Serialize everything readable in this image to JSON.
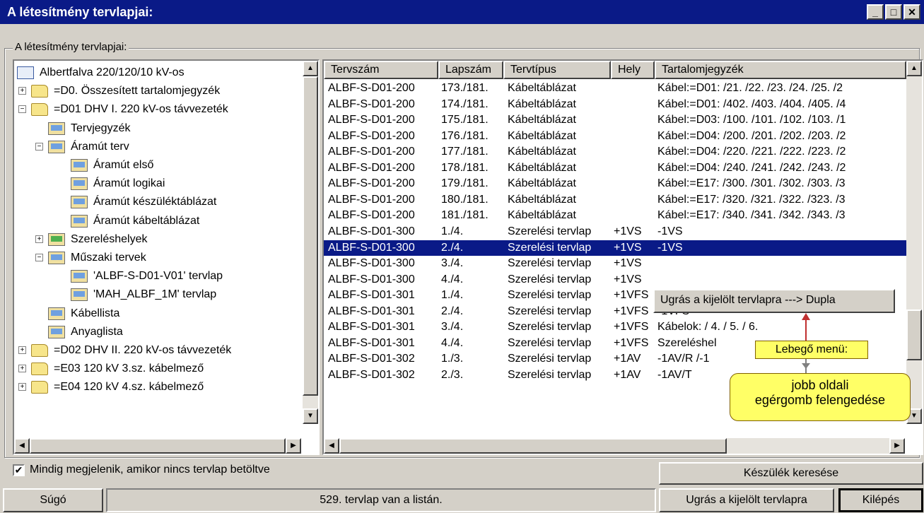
{
  "window": {
    "title": "A létesítmény tervlapjai:"
  },
  "group_label": "A létesítmény tervlapjai:",
  "tree": [
    {
      "label": "Albertfalva 220/120/10 kV-os",
      "icon": "document-icon",
      "level": 0,
      "expander": ""
    },
    {
      "label": "=D0. Összesített tartalomjegyzék",
      "icon": "folder-icon",
      "level": 1,
      "expander": "+"
    },
    {
      "label": "=D01 DHV I. 220 kV-os távvezeték",
      "icon": "folder-open-icon",
      "level": 1,
      "expander": "-"
    },
    {
      "label": "Tervjegyzék",
      "icon": "sheet-icon",
      "level": 2,
      "expander": ""
    },
    {
      "label": "Áramút terv",
      "icon": "sheet-icon",
      "level": 2,
      "expander": "-"
    },
    {
      "label": "Áramút első",
      "icon": "sheet-icon",
      "level": 3,
      "expander": ""
    },
    {
      "label": "Áramút logikai",
      "icon": "sheet-icon",
      "level": 3,
      "expander": ""
    },
    {
      "label": "Áramút készüléktáblázat",
      "icon": "sheet-icon",
      "level": 3,
      "expander": ""
    },
    {
      "label": "Áramút kábeltáblázat",
      "icon": "sheet-icon",
      "level": 3,
      "expander": ""
    },
    {
      "label": "Szereléshelyek",
      "icon": "sheet-green-icon",
      "level": 2,
      "expander": "+"
    },
    {
      "label": "Műszaki tervek",
      "icon": "sheet-icon",
      "level": 2,
      "expander": "-"
    },
    {
      "label": "'ALBF-S-D01-V01' tervlap",
      "icon": "sheet-icon",
      "level": 3,
      "expander": ""
    },
    {
      "label": "'MAH_ALBF_1M' tervlap",
      "icon": "sheet-icon",
      "level": 3,
      "expander": ""
    },
    {
      "label": "Kábellista",
      "icon": "sheet-icon",
      "level": 2,
      "expander": ""
    },
    {
      "label": "Anyaglista",
      "icon": "sheet-icon",
      "level": 2,
      "expander": ""
    },
    {
      "label": "=D02 DHV II. 220 kV-os távvezeték",
      "icon": "folder-icon",
      "level": 1,
      "expander": "+"
    },
    {
      "label": "=E03 120 kV 3.sz. kábelmező",
      "icon": "folder-icon",
      "level": 1,
      "expander": "+"
    },
    {
      "label": "=E04 120 kV 4.sz. kábelmező",
      "icon": "folder-icon",
      "level": 1,
      "expander": "+"
    }
  ],
  "list": {
    "columns": [
      "Tervszám",
      "Lapszám",
      "Tervtípus",
      "Hely",
      "Tartalomjegyzék"
    ],
    "rows": [
      [
        "ALBF-S-D01-200",
        "173./181.",
        "Kábeltáblázat",
        "",
        "Kábel:=D01: /21. /22. /23. /24. /25. /2"
      ],
      [
        "ALBF-S-D01-200",
        "174./181.",
        "Kábeltáblázat",
        "",
        "Kábel:=D01: /402. /403. /404. /405. /4"
      ],
      [
        "ALBF-S-D01-200",
        "175./181.",
        "Kábeltáblázat",
        "",
        "Kábel:=D03: /100. /101. /102. /103. /1"
      ],
      [
        "ALBF-S-D01-200",
        "176./181.",
        "Kábeltáblázat",
        "",
        "Kábel:=D04: /200. /201. /202. /203. /2"
      ],
      [
        "ALBF-S-D01-200",
        "177./181.",
        "Kábeltáblázat",
        "",
        "Kábel:=D04: /220. /221. /222. /223. /2"
      ],
      [
        "ALBF-S-D01-200",
        "178./181.",
        "Kábeltáblázat",
        "",
        "Kábel:=D04: /240. /241. /242. /243. /2"
      ],
      [
        "ALBF-S-D01-200",
        "179./181.",
        "Kábeltáblázat",
        "",
        "Kábel:=E17: /300. /301. /302. /303. /3"
      ],
      [
        "ALBF-S-D01-200",
        "180./181.",
        "Kábeltáblázat",
        "",
        "Kábel:=E17: /320. /321. /322. /323. /3"
      ],
      [
        "ALBF-S-D01-200",
        "181./181.",
        "Kábeltáblázat",
        "",
        "Kábel:=E17: /340. /341. /342. /343. /3"
      ],
      [
        "ALBF-S-D01-300",
        "1./4.",
        "Szerelési tervlap",
        "+1VS",
        "-1VS"
      ],
      [
        "ALBF-S-D01-300",
        "2./4.",
        "Szerelési tervlap",
        "+1VS",
        "-1VS"
      ],
      [
        "ALBF-S-D01-300",
        "3./4.",
        "Szerelési tervlap",
        "+1VS",
        ""
      ],
      [
        "ALBF-S-D01-300",
        "4./4.",
        "Szerelési tervlap",
        "+1VS",
        ""
      ],
      [
        "ALBF-S-D01-301",
        "1./4.",
        "Szerelési tervlap",
        "+1VFS",
        "-1VFS"
      ],
      [
        "ALBF-S-D01-301",
        "2./4.",
        "Szerelési tervlap",
        "+1VFS",
        "-1VFS"
      ],
      [
        "ALBF-S-D01-301",
        "3./4.",
        "Szerelési tervlap",
        "+1VFS",
        "Kábelok: / 4. / 5. / 6."
      ],
      [
        "ALBF-S-D01-301",
        "4./4.",
        "Szerelési tervlap",
        "+1VFS",
        "Szereléshel"
      ],
      [
        "ALBF-S-D01-302",
        "1./3.",
        "Szerelési tervlap",
        "+1AV",
        "-1AV/R /-1"
      ],
      [
        "ALBF-S-D01-302",
        "2./3.",
        "Szerelési tervlap",
        "+1AV",
        "-1AV/T"
      ]
    ],
    "selected_index": 10
  },
  "popup_menu": {
    "label": "Ugrás a kijelölt tervlapra ---> Dupla"
  },
  "callouts": {
    "menu_label": "Lebegő menü:",
    "release_line1": "jobb oldali",
    "release_line2": "egérgomb felengedése"
  },
  "checkbox": {
    "label": "Mindig megjelenik, amikor nincs tervlap betöltve",
    "checked": true,
    "mark": "✔"
  },
  "buttons": {
    "find_device": "Készülék keresése",
    "help": "Súgó",
    "jump": "Ugrás a kijelölt tervlapra",
    "exit": "Kilépés"
  },
  "status": "529. tervlap van a listán.",
  "colors": {
    "title_bar": "#0a1a87",
    "selection": "#0a1a87",
    "callout": "#ffff66",
    "arrow": "#c03030"
  }
}
